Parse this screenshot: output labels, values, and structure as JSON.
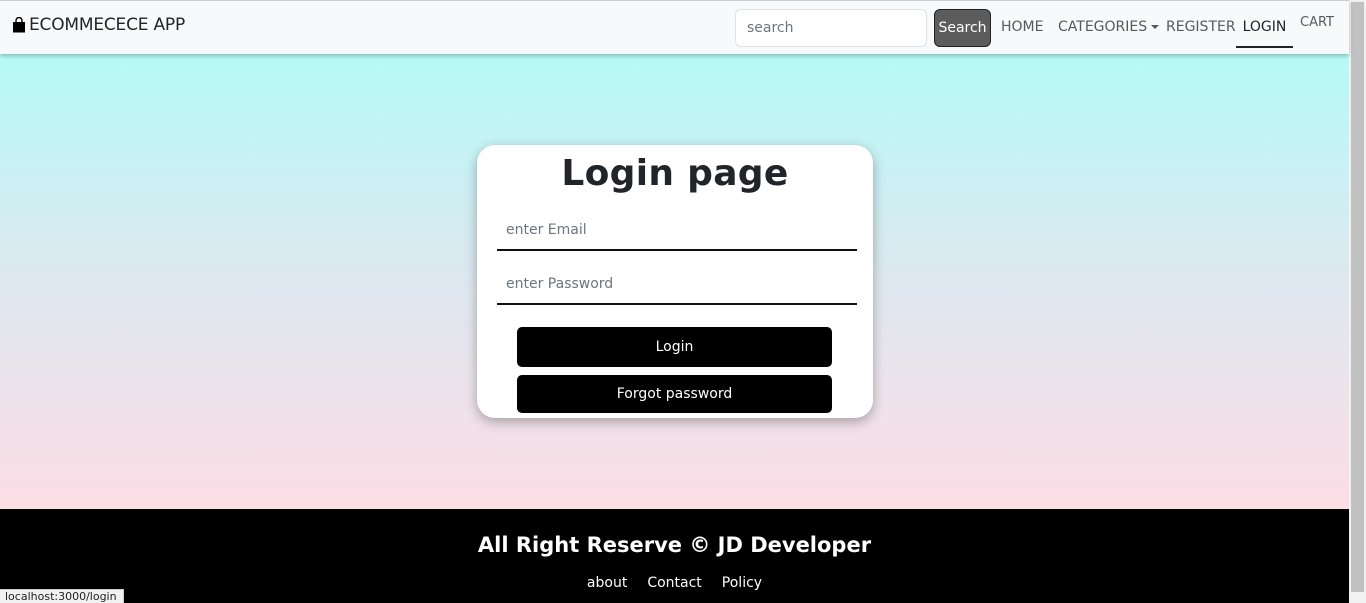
{
  "navbar": {
    "brand": "ECOMMECECE APP",
    "brand_icon": "shopping-bag-icon",
    "search_placeholder": "search",
    "search_button": "Search",
    "links": {
      "home": "HOME",
      "categories": "CATEGORIES",
      "register": "REGISTER",
      "login": "LOGIN",
      "cart": "CART"
    }
  },
  "login_card": {
    "title": "Login page",
    "email_placeholder": "enter Email",
    "password_placeholder": "enter Password",
    "login_button": "Login",
    "forgot_button": "Forgot password"
  },
  "footer": {
    "title": "All Right Reserve © JD Developer",
    "links": [
      "about",
      "Contact",
      "Policy"
    ]
  },
  "status_bar": {
    "url": "localhost:3000/login"
  },
  "colors": {
    "gradient_top": "#b4fbf6",
    "gradient_bottom": "#fddde6",
    "button_bg": "#000000",
    "search_button_bg": "#5c5c5c"
  }
}
